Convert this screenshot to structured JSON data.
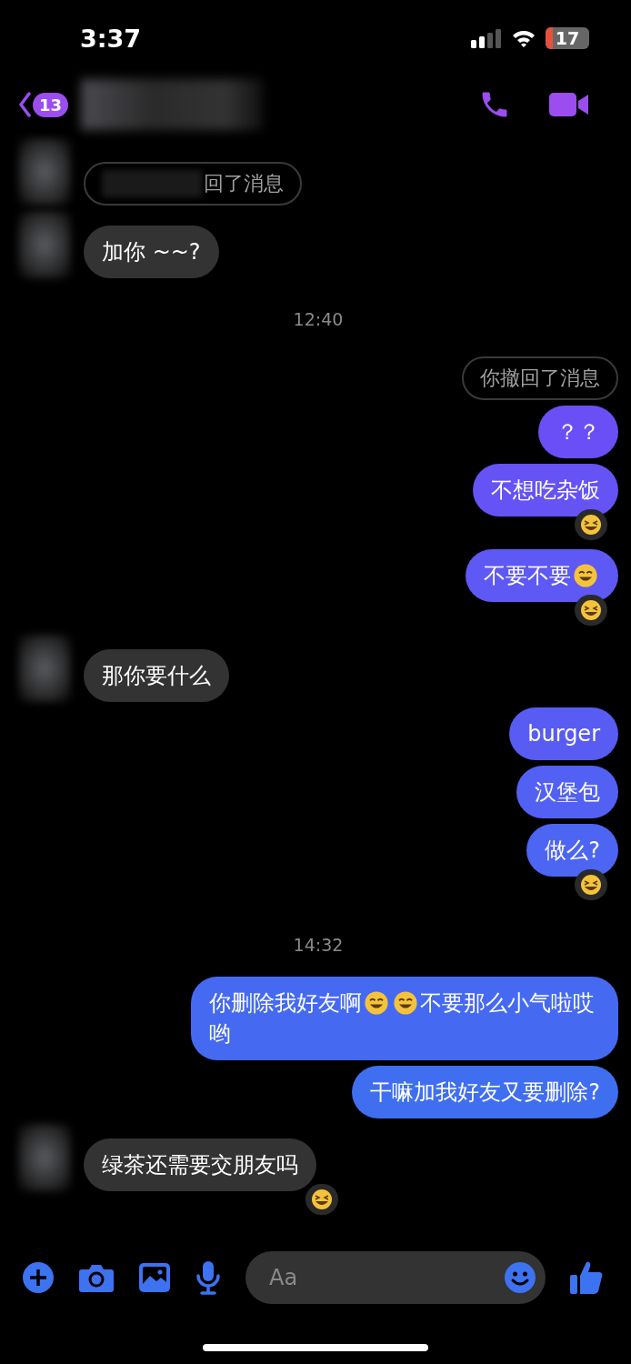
{
  "status_bar": {
    "time": "3:37",
    "battery": "17"
  },
  "header": {
    "unread_count": "13"
  },
  "messages": [
    {
      "kind": "recalled-other",
      "text": "回了消息",
      "avatar": true
    },
    {
      "kind": "incoming",
      "parts": [
        {
          "kind": "text",
          "text": "加你 ~~?"
        }
      ],
      "avatar": true,
      "reacted": false
    },
    {
      "kind": "time",
      "text": "12:40"
    },
    {
      "kind": "recalled-self",
      "text": "你撤回了消息"
    },
    {
      "kind": "outgoing",
      "parts": [
        {
          "kind": "text",
          "text": "？？"
        }
      ],
      "reacted": false
    },
    {
      "kind": "outgoing",
      "parts": [
        {
          "kind": "text",
          "text": "不想吃杂饭"
        }
      ],
      "reacted": true
    },
    {
      "kind": "outgoing",
      "parts": [
        {
          "kind": "text",
          "text": "不要不要"
        },
        {
          "kind": "emoji"
        }
      ],
      "reacted": true
    },
    {
      "kind": "incoming",
      "parts": [
        {
          "kind": "text",
          "text": "那你要什么"
        }
      ],
      "avatar": true,
      "reacted": false
    },
    {
      "kind": "outgoing",
      "parts": [
        {
          "kind": "text",
          "text": "burger"
        }
      ],
      "reacted": false
    },
    {
      "kind": "outgoing",
      "parts": [
        {
          "kind": "text",
          "text": "汉堡包"
        }
      ],
      "reacted": false
    },
    {
      "kind": "outgoing",
      "parts": [
        {
          "kind": "text",
          "text": "做么?"
        }
      ],
      "reacted": true
    },
    {
      "kind": "time",
      "text": "14:32"
    },
    {
      "kind": "outgoing",
      "parts": [
        {
          "kind": "text",
          "text": "你删除我好友啊"
        },
        {
          "kind": "emoji"
        },
        {
          "kind": "emoji"
        },
        {
          "kind": "text",
          "text": "不要那么小气啦哎哟"
        }
      ],
      "reacted": false
    },
    {
      "kind": "outgoing",
      "parts": [
        {
          "kind": "text",
          "text": "干嘛加我好友又要删除?"
        }
      ],
      "reacted": false
    },
    {
      "kind": "incoming",
      "parts": [
        {
          "kind": "text",
          "text": "绿茶还需要交朋友吗"
        }
      ],
      "avatar": true,
      "reacted": true
    }
  ],
  "composer": {
    "placeholder": "Aa"
  }
}
